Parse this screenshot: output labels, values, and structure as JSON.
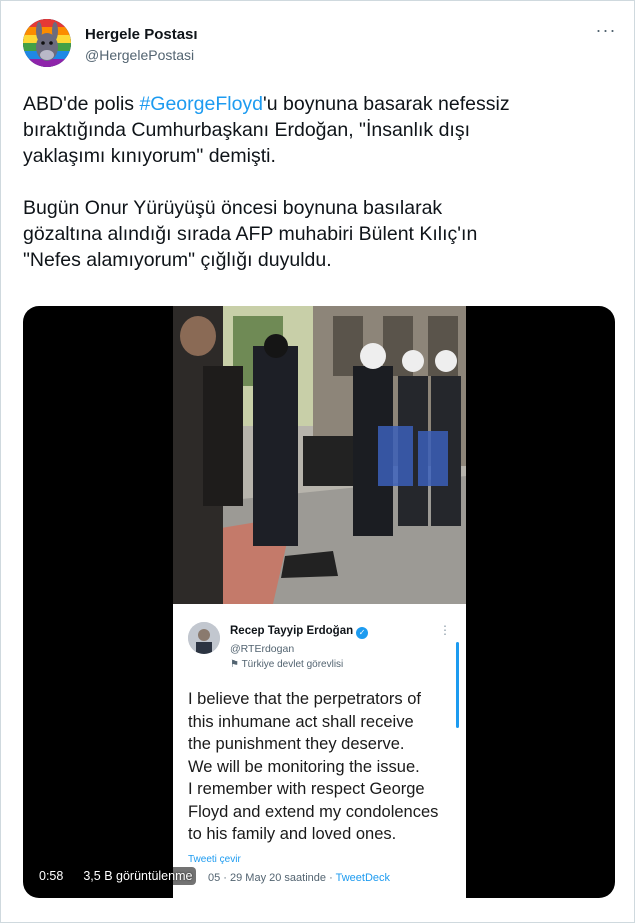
{
  "tweet": {
    "author": {
      "display_name": "Hergele Postası",
      "handle": "@HergelePostasi",
      "avatar_icon": "donkey-rainbow-avatar"
    },
    "more_icon": "more-dots-icon",
    "text_part1_prefix": "ABD'de polis ",
    "hashtag": "#GeorgeFloyd",
    "text_part1_suffix": "'u boynuna basarak nefessiz\nbıraktığında Cumhurbaşkanı Erdoğan, \"İnsanlık dışı\nyaklaşımı kınıyorum\" demişti.",
    "text_part2": "Bugün Onur Yürüyüşü öncesi boynuna basılarak\ngözaltına alındığı sırada AFP muhabiri Bülent Kılıç'ın\n\"Nefes alamıyorum\" çığlığı duyuldu.",
    "colors": {
      "link": "#1d9bf0",
      "text": "#0f1419",
      "secondary": "#536471"
    }
  },
  "media": {
    "type": "video",
    "embedded_tweet": {
      "name": "Recep Tayyip Erdoğan",
      "handle": "@RTErdogan",
      "label": "Türkiye devlet görevlisi",
      "text": "I believe that the perpetrators of\nthis inhumane act shall receive\nthe punishment they deserve.\nWe will be monitoring the issue.\nI remember with respect George\nFloyd and extend my condolences\nto his family and loved ones.",
      "translate_label": "Tweeti çevir",
      "timestamp": "05 · 29 May 20 saatinde · ",
      "source": "TweetDeck"
    },
    "controls": {
      "time": "0:58",
      "views": "3,5 B görüntülenme"
    }
  }
}
